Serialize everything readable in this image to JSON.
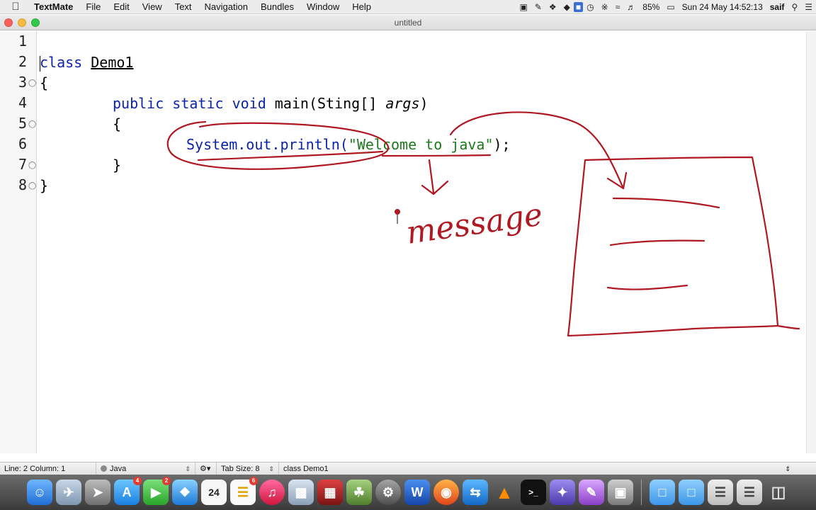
{
  "menubar": {
    "app_name": "TextMate",
    "items": [
      "File",
      "Edit",
      "View",
      "Text",
      "Navigation",
      "Bundles",
      "Window",
      "Help"
    ],
    "battery": "85%",
    "clock": "Sun 24 May  14:52:13",
    "user": "saif"
  },
  "window": {
    "title": "untitled"
  },
  "editor": {
    "line_numbers": [
      "1",
      "2",
      "3",
      "4",
      "5",
      "6",
      "7",
      "8"
    ],
    "code": {
      "l2_kw": "class",
      "l2_name": "Demo1",
      "l3": "{",
      "l4_kw": "public static void",
      "l4_method": " main(Sting[] ",
      "l4_arg": "args",
      "l4_close": ")",
      "l5": "{",
      "l6_call": "System.out.println(",
      "l6_str": "\"Welcome to java\"",
      "l6_end": ");",
      "l7": "}",
      "l8": "}"
    },
    "annotation_text": "message",
    "annotation_color": "#b01822"
  },
  "statusbar": {
    "position": "Line: 2   Column: 1",
    "language": "Java",
    "tab_size_label": "Tab Size:",
    "tab_size": "8",
    "symbol": "class Demo1"
  },
  "dock": {
    "badges": {
      "appstore": "4",
      "facetime": "2",
      "itunes": "6"
    },
    "calendar_day": "24"
  }
}
